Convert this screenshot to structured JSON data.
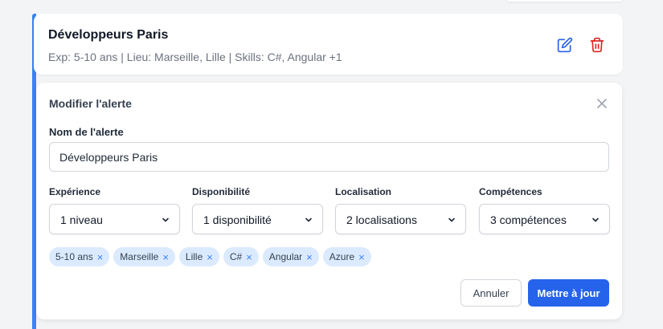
{
  "alert": {
    "title": "Développeurs Paris",
    "meta": "Exp: 5-10 ans | Lieu: Marseille, Lille | Skills: C#, Angular +1",
    "edit_icon": "pencil-square-icon",
    "delete_icon": "trash-icon"
  },
  "panel": {
    "title": "Modifier l'alerte",
    "close_icon": "close-icon",
    "name_label": "Nom de l'alerte",
    "name_value": "Développeurs Paris",
    "selects": [
      {
        "label": "Expérience",
        "value": "1 niveau"
      },
      {
        "label": "Disponibilité",
        "value": "1 disponibilité"
      },
      {
        "label": "Localisation",
        "value": "2 localisations"
      },
      {
        "label": "Compétences",
        "value": "3 compétences"
      }
    ],
    "tags": [
      "5-10 ans",
      "Marseille",
      "Lille",
      "C#",
      "Angular",
      "Azure"
    ],
    "tag_remove": "×",
    "cancel_label": "Annuler",
    "submit_label": "Mettre à jour"
  },
  "colors": {
    "accent": "#3b82f6",
    "primary_button": "#2563eb",
    "edit_icon": "#2563eb",
    "delete_icon": "#dc2626",
    "tag_bg": "#dbeafe"
  }
}
